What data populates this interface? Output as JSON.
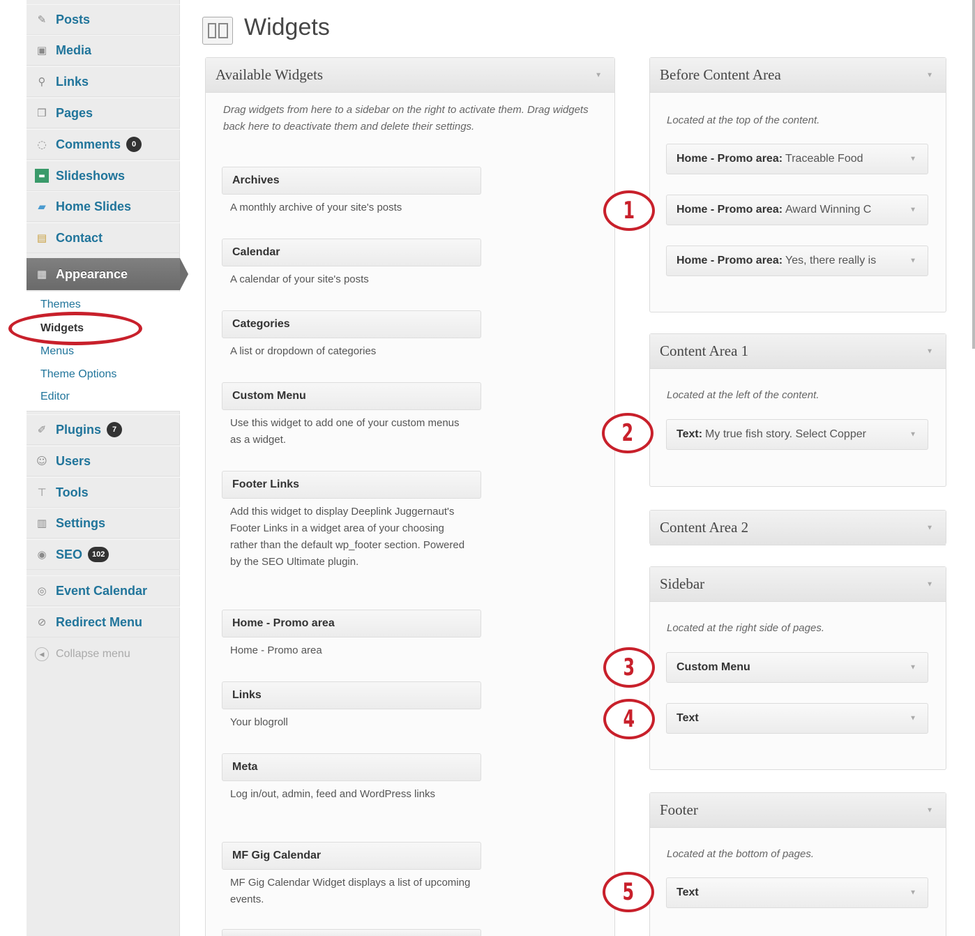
{
  "sidebar": {
    "items": [
      {
        "label": "Posts",
        "icon": "pin-icon"
      },
      {
        "label": "Media",
        "icon": "media-icon"
      },
      {
        "label": "Links",
        "icon": "link-icon"
      },
      {
        "label": "Pages",
        "icon": "pages-icon"
      },
      {
        "label": "Comments",
        "icon": "comment-icon",
        "badge": "0"
      },
      {
        "label": "Slideshows",
        "icon": "slideshow-icon"
      },
      {
        "label": "Home Slides",
        "icon": "slides-icon"
      },
      {
        "label": "Contact",
        "icon": "contact-icon"
      },
      {
        "label": "Appearance",
        "icon": "appearance-icon"
      },
      {
        "label": "Plugins",
        "icon": "plugin-icon",
        "badge": "7"
      },
      {
        "label": "Users",
        "icon": "users-icon"
      },
      {
        "label": "Tools",
        "icon": "tools-icon"
      },
      {
        "label": "Settings",
        "icon": "settings-icon"
      },
      {
        "label": "SEO",
        "icon": "seo-icon",
        "badge": "102"
      },
      {
        "label": "Event Calendar",
        "icon": "calendar-icon"
      },
      {
        "label": "Redirect Menu",
        "icon": "redirect-icon"
      }
    ],
    "appearance_submenu": [
      "Themes",
      "Widgets",
      "Menus",
      "Theme Options",
      "Editor"
    ],
    "collapse_label": "Collapse menu"
  },
  "header": {
    "title": "Widgets"
  },
  "available": {
    "title": "Available Widgets",
    "description": "Drag widgets from here to a sidebar on the right to activate them. Drag widgets back here to deactivate them and delete their settings.",
    "widgets": [
      {
        "name": "Archives",
        "desc": "A monthly archive of your site's posts"
      },
      {
        "name": "Calendar",
        "desc": "A calendar of your site's posts"
      },
      {
        "name": "Categories",
        "desc": "A list or dropdown of categories"
      },
      {
        "name": "Custom Menu",
        "desc": "Use this widget to add one of your custom menus as a widget."
      },
      {
        "name": "Footer Links",
        "desc": "Add this widget to display Deeplink Juggernaut's Footer Links in a widget area of your choosing rather than the default wp_footer section. Powered by the SEO Ultimate plugin."
      },
      {
        "name": "Home - Promo area",
        "desc": "Home - Promo area"
      },
      {
        "name": "Links",
        "desc": "Your blogroll"
      },
      {
        "name": "Meta",
        "desc": "Log in/out, admin, feed and WordPress links"
      },
      {
        "name": "MF Gig Calendar",
        "desc": "MF Gig Calendar Widget displays a list of upcoming events."
      }
    ]
  },
  "areas": {
    "before": {
      "title": "Before Content Area",
      "description": "Located at the top of the content.",
      "widgets": [
        {
          "type": "Home - Promo area:",
          "value": "Traceable Food"
        },
        {
          "type": "Home - Promo area:",
          "value": "Award Winning C"
        },
        {
          "type": "Home - Promo area:",
          "value": "Yes, there really is"
        }
      ]
    },
    "content1": {
      "title": "Content Area 1",
      "description": "Located at the left of the content.",
      "widgets": [
        {
          "type": "Text:",
          "value": "My true fish story. Select Copper"
        }
      ]
    },
    "content2": {
      "title": "Content Area 2"
    },
    "sidebar": {
      "title": "Sidebar",
      "description": "Located at the right side of pages.",
      "widgets": [
        {
          "type": "Custom Menu",
          "value": ""
        },
        {
          "type": "Text",
          "value": ""
        }
      ]
    },
    "footer": {
      "title": "Footer",
      "description": "Located at the bottom of pages.",
      "widgets": [
        {
          "type": "Text",
          "value": ""
        }
      ]
    }
  },
  "annotations": [
    "1",
    "2",
    "3",
    "4",
    "5"
  ],
  "colors": {
    "link": "#21759b",
    "annotation": "#c8202b",
    "appearance_bg": "#6f6f6f"
  }
}
